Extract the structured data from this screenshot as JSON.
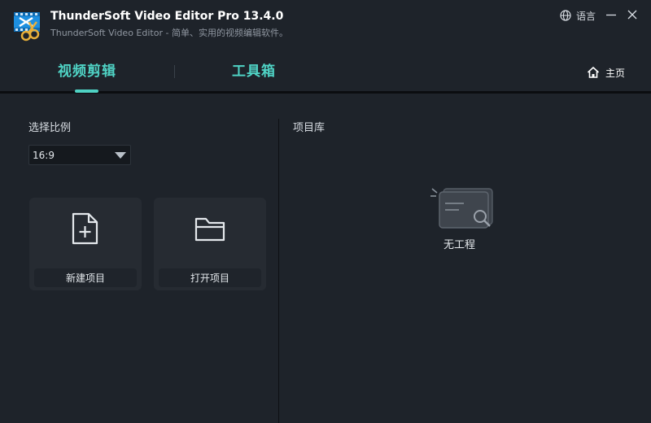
{
  "window": {
    "title": "ThunderSoft Video Editor Pro 13.4.0",
    "subtitle": "ThunderSoft Video Editor - 简单、实用的视频编辑软件。",
    "language_label": "语言"
  },
  "nav": {
    "tabs": [
      {
        "label": "视频剪辑",
        "active": true
      },
      {
        "label": "工具箱",
        "active": false
      }
    ],
    "home_label": "主页"
  },
  "left": {
    "ratio_heading": "选择比例",
    "ratio_selected": "16:9",
    "new_project_label": "新建项目",
    "open_project_label": "打开项目"
  },
  "right": {
    "library_heading": "项目库",
    "empty_label": "无工程"
  },
  "colors": {
    "background": "#1e232a",
    "accent": "#4fd2c4",
    "card": "#262b32"
  }
}
